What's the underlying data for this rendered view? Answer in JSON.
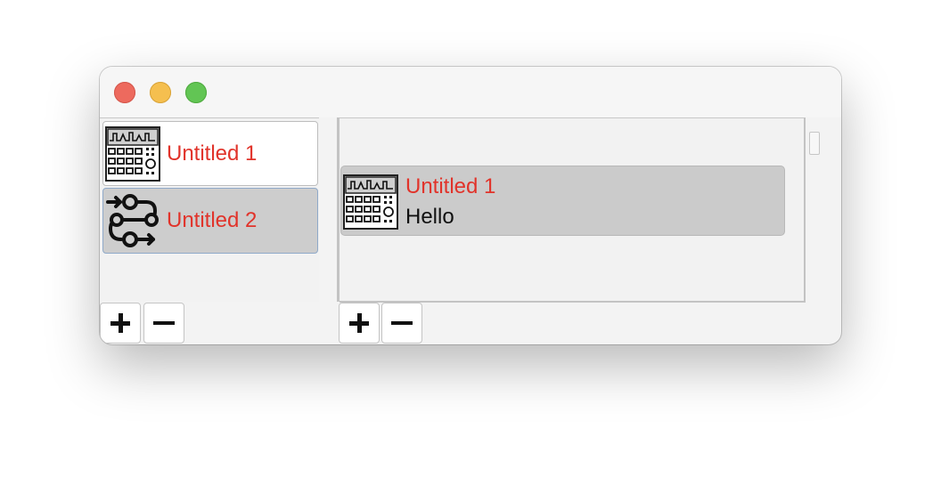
{
  "window": {
    "controls": [
      "close",
      "minimize",
      "zoom"
    ]
  },
  "sidebar": {
    "items": [
      {
        "label": "Untitled 1",
        "icon": "step-sequencer-icon",
        "selected": false
      },
      {
        "label": "Untitled 2",
        "icon": "routing-flow-icon",
        "selected": true
      }
    ],
    "add_label": "+",
    "remove_label": "−"
  },
  "detail": {
    "card": {
      "title": "Untitled 1",
      "subtitle": "Hello",
      "icon": "step-sequencer-icon"
    },
    "add_label": "+",
    "remove_label": "−"
  },
  "colors": {
    "label_red": "#e1332a",
    "selection_gray": "#cdcdcd",
    "close": "#ed6a5e",
    "minimize": "#f5bf4f",
    "zoom": "#62c554"
  }
}
